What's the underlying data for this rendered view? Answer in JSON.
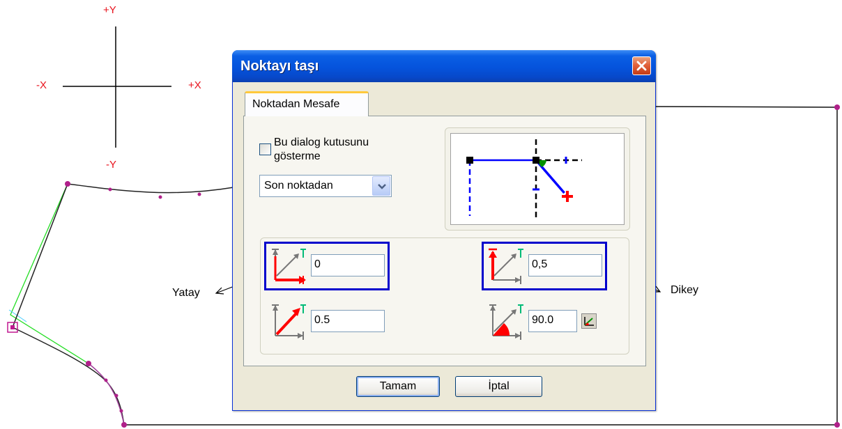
{
  "canvas": {
    "axis_labels": {
      "plus_y": "+Y",
      "minus_y": "-Y",
      "minus_x": "-X",
      "plus_x": "+X"
    },
    "annotations": {
      "horizontal": "Yatay",
      "vertical": "Dikey"
    }
  },
  "dialog": {
    "title": "Noktayı taşı",
    "tab_label": "Noktadan Mesafe",
    "checkbox": {
      "label": "Bu dialog kutusunu gösterme",
      "checked": false
    },
    "mode_select": {
      "value": "Son noktadan"
    },
    "fields": {
      "horizontal_distance": "0",
      "vertical_distance": "0,5",
      "length": "0.5",
      "angle": "90.0"
    },
    "buttons": {
      "ok": "Tamam",
      "cancel": "İptal"
    }
  },
  "colors": {
    "titlebar": "#0553dc",
    "highlight_border": "#0000cc",
    "axis_labels": "#e8121c",
    "pattern_line": "#111111",
    "curve_points": "#b0208a",
    "guide_line": "#22dd22"
  },
  "icons": [
    "close-icon",
    "dropdown-arrow-icon",
    "horizontal-distance-icon",
    "vertical-distance-icon",
    "length-icon",
    "angle-icon",
    "angle-picker-icon"
  ]
}
